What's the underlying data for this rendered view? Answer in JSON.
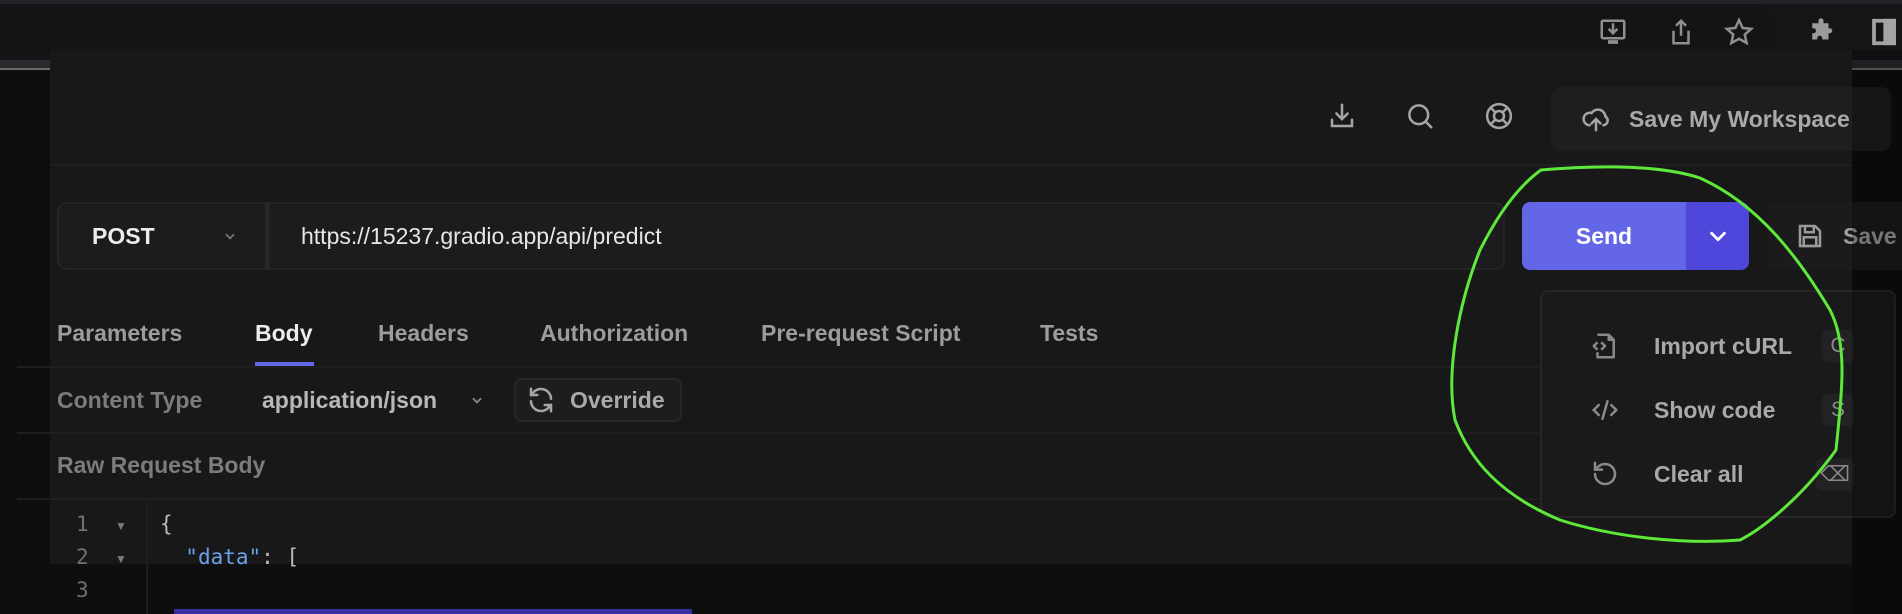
{
  "browser": {
    "toolbar_icons": [
      "install-app-icon",
      "share-icon",
      "bookmark-star-icon",
      "extensions-icon",
      "side-panel-icon"
    ]
  },
  "header": {
    "icons": [
      "download-icon",
      "search-icon",
      "help-lifebuoy-icon"
    ],
    "save_workspace_label": "Save My Workspace"
  },
  "request": {
    "method": "POST",
    "url": "https://15237.gradio.app/api/predict",
    "send_label": "Send",
    "save_label": "Save"
  },
  "tabs": [
    {
      "label": "Parameters",
      "active": false
    },
    {
      "label": "Body",
      "active": true
    },
    {
      "label": "Headers",
      "active": false
    },
    {
      "label": "Authorization",
      "active": false
    },
    {
      "label": "Pre-request Script",
      "active": false
    },
    {
      "label": "Tests",
      "active": false
    }
  ],
  "body": {
    "content_type_label": "Content Type",
    "content_type_value": "application/json",
    "override_label": "Override",
    "raw_label": "Raw Request Body",
    "lines": [
      {
        "number": "1",
        "text": "{"
      },
      {
        "number": "2",
        "key": "\"data\"",
        "rest": ": ["
      },
      {
        "number": "3",
        "text": ""
      }
    ]
  },
  "send_menu": {
    "items": [
      {
        "label": "Import cURL",
        "shortcut": "C",
        "icon": "file-code-icon"
      },
      {
        "label": "Show code",
        "shortcut": "S",
        "icon": "code-icon"
      },
      {
        "label": "Clear all",
        "shortcut": "⌫",
        "icon": "reset-icon"
      }
    ]
  },
  "colors": {
    "accent": "#6366e6",
    "accent_dark": "#4f46dc",
    "annotation": "#5ee83a",
    "json_key": "#6aa1ea"
  }
}
